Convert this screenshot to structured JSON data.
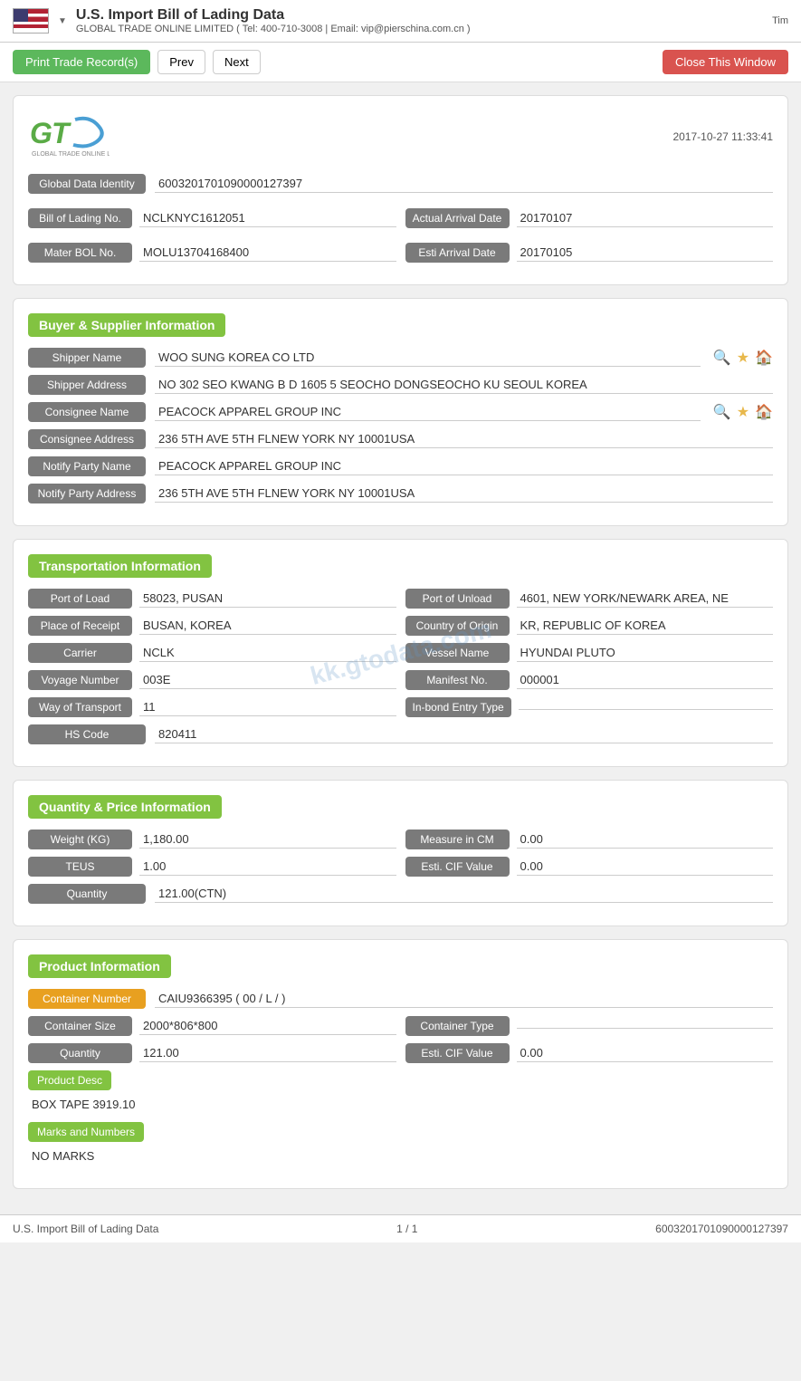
{
  "header": {
    "title": "U.S. Import Bill of Lading Data",
    "dropdown_arrow": "▼",
    "company": "GLOBAL TRADE ONLINE LIMITED ( Tel: 400-710-3008 | Email: vip@pierschina.com.cn )",
    "time": "Tim"
  },
  "toolbar": {
    "print_label": "Print Trade Record(s)",
    "prev_label": "Prev",
    "next_label": "Next",
    "close_label": "Close This Window"
  },
  "logo": {
    "timestamp": "2017-10-27 11:33:41",
    "company_name": "GLOBAL TRADE ONLINE LIMITED"
  },
  "identity": {
    "global_data_id_label": "Global Data Identity",
    "global_data_id_value": "6003201701090000127397",
    "bill_of_lading_label": "Bill of Lading No.",
    "bill_of_lading_value": "NCLKNYC1612051",
    "actual_arrival_label": "Actual Arrival Date",
    "actual_arrival_value": "20170107",
    "master_bol_label": "Mater BOL No.",
    "master_bol_value": "MOLU13704168400",
    "esti_arrival_label": "Esti Arrival Date",
    "esti_arrival_value": "20170105"
  },
  "buyer_supplier": {
    "section_title": "Buyer & Supplier Information",
    "shipper_name_label": "Shipper Name",
    "shipper_name_value": "WOO SUNG KOREA CO LTD",
    "shipper_address_label": "Shipper Address",
    "shipper_address_value": "NO 302 SEO KWANG B D 1605 5 SEOCHO DONGSEOCHO KU SEOUL KOREA",
    "consignee_name_label": "Consignee Name",
    "consignee_name_value": "PEACOCK APPAREL GROUP INC",
    "consignee_address_label": "Consignee Address",
    "consignee_address_value": "236 5TH AVE 5TH FLNEW YORK NY 10001USA",
    "notify_party_name_label": "Notify Party Name",
    "notify_party_name_value": "PEACOCK APPAREL GROUP INC",
    "notify_party_address_label": "Notify Party Address",
    "notify_party_address_value": "236 5TH AVE 5TH FLNEW YORK NY 10001USA"
  },
  "transportation": {
    "section_title": "Transportation Information",
    "port_of_load_label": "Port of Load",
    "port_of_load_value": "58023, PUSAN",
    "port_of_unload_label": "Port of Unload",
    "port_of_unload_value": "4601, NEW YORK/NEWARK AREA, NE",
    "place_of_receipt_label": "Place of Receipt",
    "place_of_receipt_value": "BUSAN, KOREA",
    "country_of_origin_label": "Country of Origin",
    "country_of_origin_value": "KR, REPUBLIC OF KOREA",
    "carrier_label": "Carrier",
    "carrier_value": "NCLK",
    "vessel_name_label": "Vessel Name",
    "vessel_name_value": "HYUNDAI PLUTO",
    "voyage_number_label": "Voyage Number",
    "voyage_number_value": "003E",
    "manifest_no_label": "Manifest No.",
    "manifest_no_value": "000001",
    "way_of_transport_label": "Way of Transport",
    "way_of_transport_value": "11",
    "in_bond_entry_label": "In-bond Entry Type",
    "in_bond_entry_value": "",
    "hs_code_label": "HS Code",
    "hs_code_value": "820411",
    "watermark": "kk.gtodata.com"
  },
  "quantity_price": {
    "section_title": "Quantity & Price Information",
    "weight_kg_label": "Weight (KG)",
    "weight_kg_value": "1,180.00",
    "measure_cm_label": "Measure in CM",
    "measure_cm_value": "0.00",
    "teus_label": "TEUS",
    "teus_value": "1.00",
    "esti_cif_label": "Esti. CIF Value",
    "esti_cif_value": "0.00",
    "quantity_label": "Quantity",
    "quantity_value": "121.00(CTN)"
  },
  "product": {
    "section_title": "Product Information",
    "container_number_label": "Container Number",
    "container_number_value": "CAIU9366395 ( 00 / L / )",
    "container_size_label": "Container Size",
    "container_size_value": "2000*806*800",
    "container_type_label": "Container Type",
    "container_type_value": "",
    "quantity_label": "Quantity",
    "quantity_value": "121.00",
    "esti_cif_label": "Esti. CIF Value",
    "esti_cif_value": "0.00",
    "product_desc_label": "Product Desc",
    "product_desc_value": "BOX TAPE 3919.10",
    "marks_label": "Marks and Numbers",
    "marks_value": "NO MARKS"
  },
  "footer": {
    "left": "U.S. Import Bill of Lading Data",
    "center": "1 / 1",
    "right": "6003201701090000127397"
  }
}
